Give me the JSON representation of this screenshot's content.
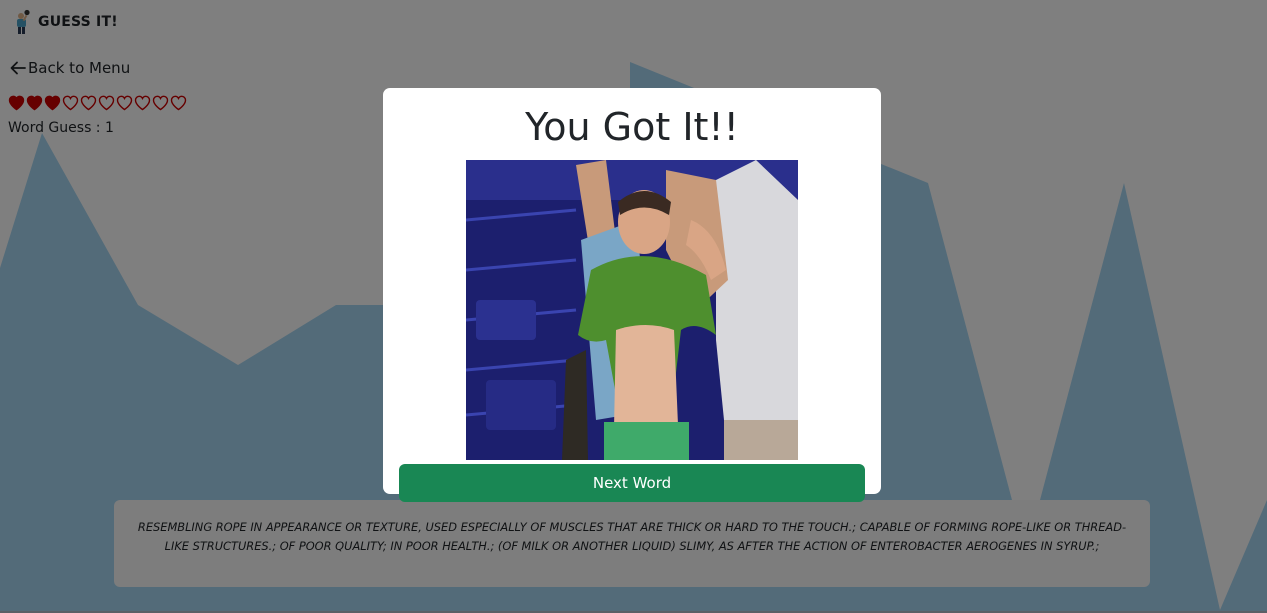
{
  "app": {
    "brand": "GUESS IT!",
    "logo_icon": "player-mascot-icon"
  },
  "nav": {
    "back_label": "Back to Menu",
    "back_icon": "arrow-left-icon"
  },
  "lives": {
    "total": 10,
    "filled": 3,
    "color": "#cc0000"
  },
  "word_guess": {
    "label": "Word Guess : ",
    "value": "1"
  },
  "definition": {
    "text": "RESEMBLING ROPE IN APPEARANCE OR TEXTURE, USED ESPECIALLY OF MUSCLES THAT ARE THICK OR HARD TO THE TOUCH.; CAPABLE OF FORMING ROPE-LIKE OR THREAD-LIKE STRUCTURES.; OF POOR QUALITY; IN POOR HEALTH.; (OF MILK OR ANOTHER LIQUID) SLIMY, AS AFTER THE ACTION OF ENTEROBACTER AEROGENES IN SYRUP.;"
  },
  "modal": {
    "title": "You Got It!!",
    "image_alt": "celebration gif",
    "next_button": "Next Word",
    "button_color": "#198754"
  },
  "colors": {
    "mountain": "#a6d6f2",
    "background": "#ffffff"
  }
}
